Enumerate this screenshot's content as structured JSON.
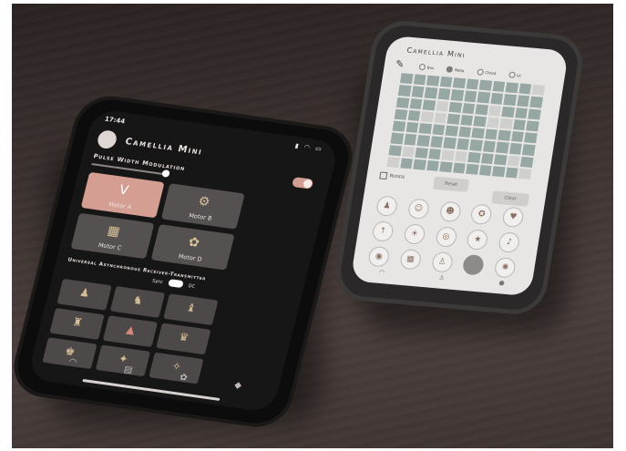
{
  "left_phone": {
    "status_time": "17:44",
    "app_title": "Camellia Mini",
    "pwm_label": "Pulse Width Modulation",
    "motors": [
      {
        "label": "Motor A",
        "active": true,
        "icon": "v-motor-icon",
        "glyph": "V"
      },
      {
        "label": "Motor B",
        "active": false,
        "icon": "sun-cube-icon",
        "glyph": "⚙"
      },
      {
        "label": "Motor C",
        "active": false,
        "icon": "cube-icon",
        "glyph": "▦"
      },
      {
        "label": "Motor D",
        "active": false,
        "icon": "gear-icon",
        "glyph": "✿"
      }
    ],
    "uart_label": "Universal Asynchronous Receiver-Transmitter",
    "sync_label": "Sync",
    "dc_label": "DC",
    "keys": [
      {
        "icon": "figure-icon",
        "glyph": "♟",
        "red": false
      },
      {
        "icon": "figure-icon",
        "glyph": "♞",
        "red": false
      },
      {
        "icon": "figure-icon",
        "glyph": "♝",
        "red": false
      },
      {
        "icon": "figure-icon",
        "glyph": "♜",
        "red": false
      },
      {
        "icon": "figure-icon",
        "glyph": "▲",
        "red": true
      },
      {
        "icon": "figure-icon",
        "glyph": "♛",
        "red": false
      },
      {
        "icon": "figure-icon",
        "glyph": "♚",
        "red": false
      },
      {
        "icon": "figure-icon",
        "glyph": "✦",
        "red": false
      },
      {
        "icon": "figure-icon",
        "glyph": "✧",
        "red": false
      }
    ],
    "tabs": [
      {
        "icon": "wifi-icon",
        "glyph": "◠"
      },
      {
        "icon": "layers-icon",
        "glyph": "▤"
      },
      {
        "icon": "flower-icon",
        "glyph": "✿"
      },
      {
        "icon": "cube-icon",
        "glyph": "◆"
      }
    ]
  },
  "right_phone": {
    "app_title": "Camellia Mini",
    "radio_options": [
      {
        "label": "Box",
        "selected": false
      },
      {
        "label": "Beep",
        "selected": true
      },
      {
        "label": "Chord",
        "selected": false
      },
      {
        "label": "Lit",
        "selected": false
      }
    ],
    "matrix": [
      [
        1,
        1,
        1,
        1,
        1,
        1,
        1,
        1,
        1,
        1,
        0
      ],
      [
        1,
        1,
        1,
        1,
        1,
        1,
        1,
        1,
        1,
        1,
        1
      ],
      [
        1,
        1,
        1,
        0,
        1,
        1,
        1,
        0,
        1,
        1,
        1
      ],
      [
        1,
        1,
        0,
        0,
        1,
        1,
        1,
        0,
        0,
        1,
        1
      ],
      [
        1,
        1,
        1,
        1,
        1,
        1,
        1,
        1,
        1,
        1,
        1
      ],
      [
        1,
        1,
        1,
        1,
        1,
        1,
        1,
        1,
        1,
        1,
        1
      ],
      [
        1,
        0,
        1,
        1,
        0,
        0,
        1,
        1,
        1,
        0,
        1
      ],
      [
        0,
        1,
        1,
        1,
        1,
        1,
        1,
        1,
        1,
        1,
        0
      ]
    ],
    "rotate_label": "Rotate",
    "reset_label": "Reset",
    "clear_label": "Clear",
    "icons": [
      {
        "icon": "figure-icon",
        "glyph": "♟",
        "dark": false
      },
      {
        "icon": "face-icon",
        "glyph": "☺",
        "dark": false
      },
      {
        "icon": "face-icon",
        "glyph": "☻",
        "dark": false
      },
      {
        "icon": "ghost-icon",
        "glyph": "✪",
        "dark": false
      },
      {
        "icon": "heart-icon",
        "glyph": "♥",
        "dark": false
      },
      {
        "icon": "arrow-icon",
        "glyph": "↑",
        "dark": false
      },
      {
        "icon": "sun-icon",
        "glyph": "☀",
        "dark": false
      },
      {
        "icon": "disc-icon",
        "glyph": "◎",
        "dark": false
      },
      {
        "icon": "star-icon",
        "glyph": "★",
        "dark": false
      },
      {
        "icon": "note-icon",
        "glyph": "♪",
        "dark": false
      },
      {
        "icon": "target-icon",
        "glyph": "◉",
        "dark": false
      },
      {
        "icon": "grid-icon",
        "glyph": "▦",
        "dark": false
      },
      {
        "icon": "figure-icon",
        "glyph": "♙",
        "dark": false
      },
      {
        "icon": "dot-icon",
        "glyph": "",
        "dark": true
      },
      {
        "icon": "sun-icon",
        "glyph": "✺",
        "dark": false
      }
    ],
    "bottom_tabs": [
      {
        "icon": "wifi-icon",
        "glyph": "◠"
      },
      {
        "icon": "person-icon",
        "glyph": "♙"
      },
      {
        "icon": "info-icon",
        "glyph": "●"
      }
    ]
  }
}
